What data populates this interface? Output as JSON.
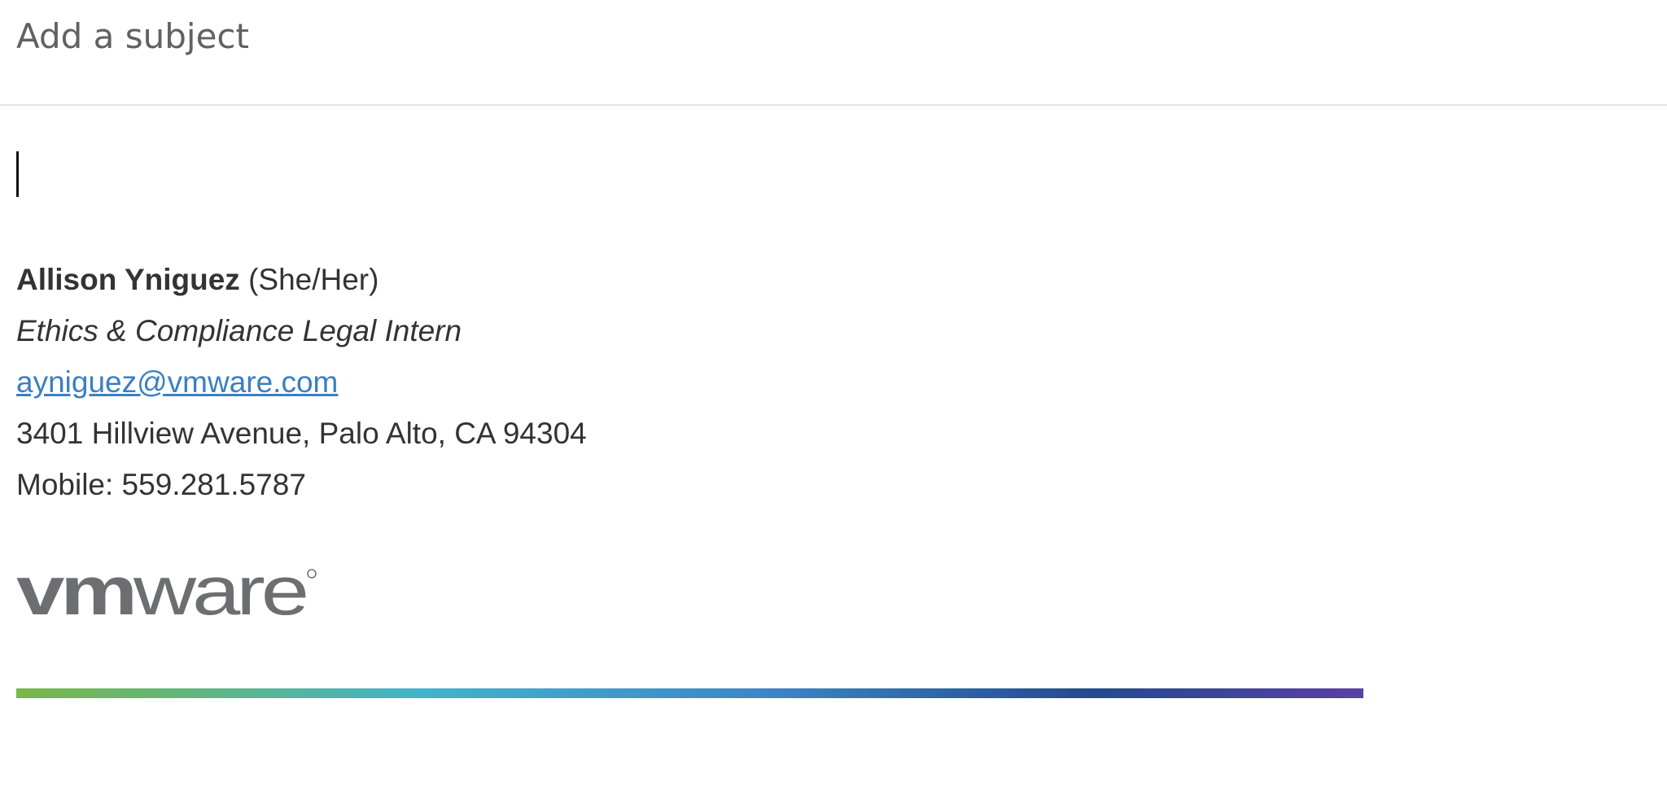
{
  "subject": {
    "placeholder": "Add a subject",
    "value": ""
  },
  "signature": {
    "name": "Allison Yniguez",
    "pronouns": "(She/Her)",
    "title": "Ethics & Compliance Legal Intern",
    "email": "ayniguez@vmware.com",
    "address": "3401 Hillview Avenue, Palo Alto, CA 94304",
    "mobile": "Mobile: 559.281.5787"
  },
  "logo": {
    "text": "vmware",
    "icon": "vmware-logo"
  },
  "colors": {
    "link": "#3a7fc1",
    "text": "#333333",
    "logo": "#6d6e71",
    "bar_gradient": [
      "#7ab648",
      "#42b4c8",
      "#3e87c8",
      "#234a8c",
      "#5b3fa6"
    ]
  }
}
